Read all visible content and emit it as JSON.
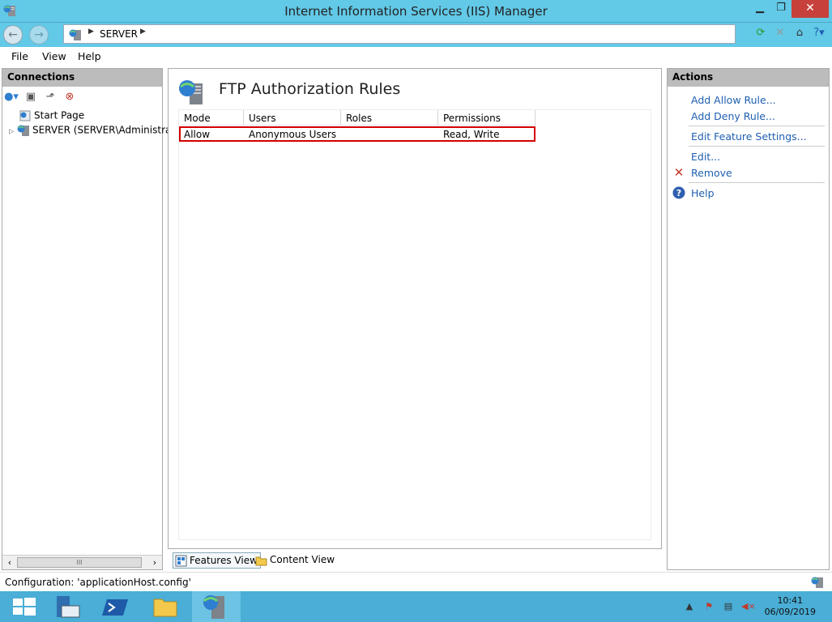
{
  "window": {
    "title": "Internet Information Services (IIS) Manager"
  },
  "address": {
    "crumb": "SERVER"
  },
  "menu": {
    "file": "File",
    "view": "View",
    "help": "Help"
  },
  "connections": {
    "header": "Connections",
    "tree": [
      {
        "label": "Start Page"
      },
      {
        "label": "SERVER (SERVER\\Administrator)"
      }
    ]
  },
  "feature": {
    "title": "FTP Authorization Rules",
    "columns": [
      "Mode",
      "Users",
      "Roles",
      "Permissions"
    ],
    "rows": [
      {
        "mode": "Allow",
        "users": "Anonymous Users",
        "roles": "",
        "permissions": "Read, Write"
      }
    ]
  },
  "view_tabs": {
    "features": "Features View",
    "content": "Content View"
  },
  "actions": {
    "header": "Actions",
    "add_allow": "Add Allow Rule...",
    "add_deny": "Add Deny Rule...",
    "edit_settings": "Edit Feature Settings...",
    "edit": "Edit...",
    "remove": "Remove",
    "help": "Help"
  },
  "status": {
    "text": "Configuration: 'applicationHost.config'"
  },
  "taskbar": {
    "time": "10:41",
    "date": "06/09/2019"
  },
  "colors": {
    "accent": "#62c9e7",
    "highlight_border": "#d40000",
    "link": "#1f5fb0",
    "remove_icon": "#c0392b"
  }
}
